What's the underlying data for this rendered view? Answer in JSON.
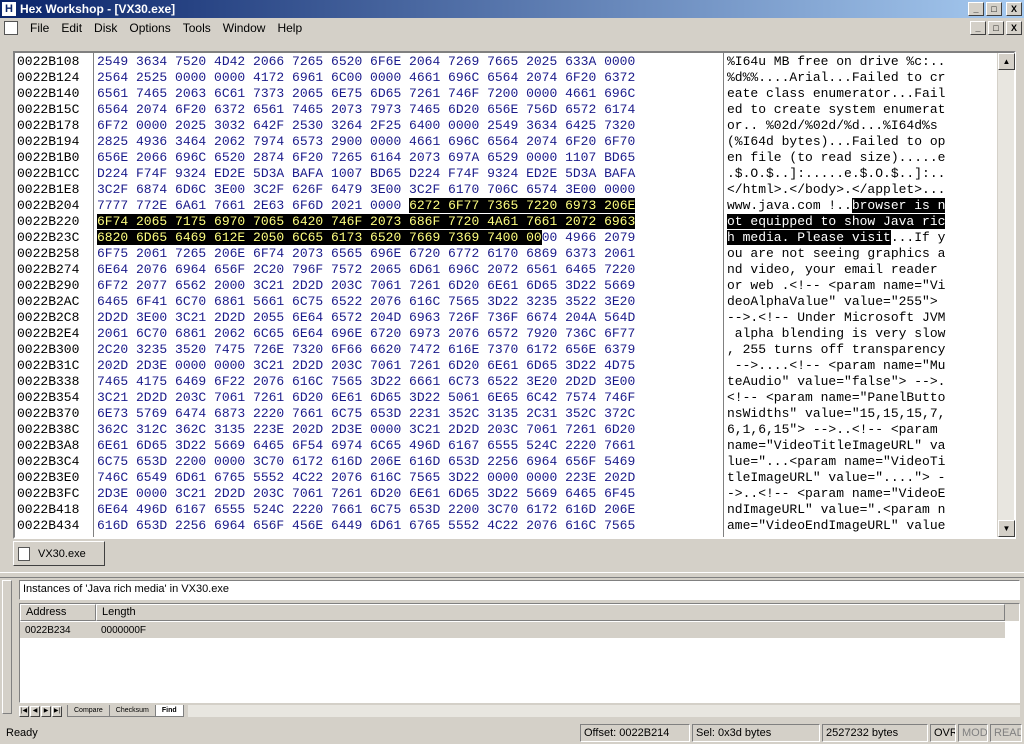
{
  "window": {
    "title": "Hex Workshop - [VX30.exe]",
    "app_icon": "H",
    "minimize": "_",
    "maximize": "□",
    "close": "X"
  },
  "menu": [
    "File",
    "Edit",
    "Disk",
    "Options",
    "Tools",
    "Window",
    "Help"
  ],
  "mdi": {
    "minimize": "_",
    "restore": "□",
    "close": "X"
  },
  "editor": {
    "rows": [
      {
        "addr": "0022B108",
        "hex": "2549 3634 7520 4D42 2066 7265 6520 6F6E 2064 7269 7665 2025 633A 0000",
        "ascii": "%I64u MB free on drive %c:.."
      },
      {
        "addr": "0022B124",
        "hex": "2564 2525 0000 0000 4172 6961 6C00 0000 4661 696C 6564 2074 6F20 6372",
        "ascii": "%d%%....Arial...Failed to cr"
      },
      {
        "addr": "0022B140",
        "hex": "6561 7465 2063 6C61 7373 2065 6E75 6D65 7261 746F 7200 0000 4661 696C",
        "ascii": "eate class enumerator...Fail"
      },
      {
        "addr": "0022B15C",
        "hex": "6564 2074 6F20 6372 6561 7465 2073 7973 7465 6D20 656E 756D 6572 6174",
        "ascii": "ed to create system enumerat"
      },
      {
        "addr": "0022B178",
        "hex": "6F72 0000 2025 3032 642F 2530 3264 2F25 6400 0000 2549 3634 6425 7320",
        "ascii": "or.. %02d/%02d/%d...%I64d%s "
      },
      {
        "addr": "0022B194",
        "hex": "2825 4936 3464 2062 7974 6573 2900 0000 4661 696C 6564 2074 6F20 6F70",
        "ascii": "(%I64d bytes)...Failed to op"
      },
      {
        "addr": "0022B1B0",
        "hex": "656E 2066 696C 6520 2874 6F20 7265 6164 2073 697A 6529 0000 1107 BD65",
        "ascii": "en file (to read size).....e"
      },
      {
        "addr": "0022B1CC",
        "hex": "D224 F74F 9324 ED2E 5D3A BAFA 1007 BD65 D224 F74F 9324 ED2E 5D3A BAFA",
        "ascii": ".$.O.$..]:.....e.$.O.$..]:.."
      },
      {
        "addr": "0022B1E8",
        "hex": "3C2F 6874 6D6C 3E00 3C2F 626F 6479 3E00 3C2F 6170 706C 6574 3E00 0000",
        "ascii": "</html>.</body>.</applet>..."
      },
      {
        "addr": "0022B204",
        "hex": "7777 772E 6A61 7661 2E63 6F6D 2021 0000 6272 6F77 7365 7220 6973 206E",
        "ascii": "www.java.com !..browser is n",
        "hex_sel_from": 40,
        "asc_sel_from": 16
      },
      {
        "addr": "0022B220",
        "hex": "6F74 2065 7175 6970 7065 6420 746F 2073 686F 7720 4A61 7661 2072 6963",
        "ascii": "ot equipped to show Java ric",
        "hex_sel_from": 0,
        "asc_sel_from": 0
      },
      {
        "addr": "0022B23C",
        "hex": "6820 6D65 6469 612E 2050 6C65 6173 6520 7669 7369 7400 0000 4966 2079",
        "ascii": "h media. Please visit...If y",
        "hex_sel_from": 0,
        "hex_sel_to": 57,
        "asc_sel_from": 0,
        "asc_sel_to": 21
      },
      {
        "addr": "0022B258",
        "hex": "6F75 2061 7265 206E 6F74 2073 6565 696E 6720 6772 6170 6869 6373 2061",
        "ascii": "ou are not seeing graphics a"
      },
      {
        "addr": "0022B274",
        "hex": "6E64 2076 6964 656F 2C20 796F 7572 2065 6D61 696C 2072 6561 6465 7220",
        "ascii": "nd video, your email reader "
      },
      {
        "addr": "0022B290",
        "hex": "6F72 2077 6562 2000 3C21 2D2D 203C 7061 7261 6D20 6E61 6D65 3D22 5669",
        "ascii": "or web .<!-- <param name=\"Vi"
      },
      {
        "addr": "0022B2AC",
        "hex": "6465 6F41 6C70 6861 5661 6C75 6522 2076 616C 7565 3D22 3235 3522 3E20",
        "ascii": "deoAlphaValue\" value=\"255\"> "
      },
      {
        "addr": "0022B2C8",
        "hex": "2D2D 3E00 3C21 2D2D 2055 6E64 6572 204D 6963 726F 736F 6674 204A 564D",
        "ascii": "-->.<!-- Under Microsoft JVM"
      },
      {
        "addr": "0022B2E4",
        "hex": "2061 6C70 6861 2062 6C65 6E64 696E 6720 6973 2076 6572 7920 736C 6F77",
        "ascii": " alpha blending is very slow"
      },
      {
        "addr": "0022B300",
        "hex": "2C20 3235 3520 7475 726E 7320 6F66 6620 7472 616E 7370 6172 656E 6379",
        "ascii": ", 255 turns off transparency"
      },
      {
        "addr": "0022B31C",
        "hex": "202D 2D3E 0000 0000 3C21 2D2D 203C 7061 7261 6D20 6E61 6D65 3D22 4D75",
        "ascii": " -->....<!-- <param name=\"Mu"
      },
      {
        "addr": "0022B338",
        "hex": "7465 4175 6469 6F22 2076 616C 7565 3D22 6661 6C73 6522 3E20 2D2D 3E00",
        "ascii": "teAudio\" value=\"false\"> -->."
      },
      {
        "addr": "0022B354",
        "hex": "3C21 2D2D 203C 7061 7261 6D20 6E61 6D65 3D22 5061 6E65 6C42 7574 746F",
        "ascii": "<!-- <param name=\"PanelButto"
      },
      {
        "addr": "0022B370",
        "hex": "6E73 5769 6474 6873 2220 7661 6C75 653D 2231 352C 3135 2C31 352C 372C",
        "ascii": "nsWidths\" value=\"15,15,15,7,"
      },
      {
        "addr": "0022B38C",
        "hex": "362C 312C 362C 3135 223E 202D 2D3E 0000 3C21 2D2D 203C 7061 7261 6D20",
        "ascii": "6,1,6,15\"> -->..<!-- <param "
      },
      {
        "addr": "0022B3A8",
        "hex": "6E61 6D65 3D22 5669 6465 6F54 6974 6C65 496D 6167 6555 524C 2220 7661",
        "ascii": "name=\"VideoTitleImageURL\" va"
      },
      {
        "addr": "0022B3C4",
        "hex": "6C75 653D 2200 0000 3C70 6172 616D 206E 616D 653D 2256 6964 656F 5469",
        "ascii": "lue=\"...<param name=\"VideoTi"
      },
      {
        "addr": "0022B3E0",
        "hex": "746C 6549 6D61 6765 5552 4C22 2076 616C 7565 3D22 0000 0000 223E 202D",
        "ascii": "tleImageURL\" value=\"....\"> -"
      },
      {
        "addr": "0022B3FC",
        "hex": "2D3E 0000 3C21 2D2D 203C 7061 7261 6D20 6E61 6D65 3D22 5669 6465 6F45",
        "ascii": "->..<!-- <param name=\"VideoE"
      },
      {
        "addr": "0022B418",
        "hex": "6E64 496D 6167 6555 524C 2220 7661 6C75 653D 2200 3C70 6172 616D 206E",
        "ascii": "ndImageURL\" value=\".<param n"
      },
      {
        "addr": "0022B434",
        "hex": "616D 653D 2256 6964 656F 456E 6449 6D61 6765 5552 4C22 2076 616C 7565",
        "ascii": "ame=\"VideoEndImageURL\" value"
      }
    ]
  },
  "doc_tab": {
    "label": "VX30.exe"
  },
  "results": {
    "title": "Instances of 'Java rich media' in VX30.exe",
    "columns": [
      "Address",
      "Length"
    ],
    "rows": [
      {
        "address": "0022B234",
        "length": "0000000F"
      }
    ],
    "tabs": [
      "Compare",
      "Checksum",
      "Find"
    ]
  },
  "status": {
    "ready": "Ready",
    "offset": "Offset: 0022B214",
    "sel": "Sel: 0x3d bytes",
    "size": "2527232 bytes",
    "ovr": "OVR",
    "mod": "MOD",
    "read": "READ"
  }
}
